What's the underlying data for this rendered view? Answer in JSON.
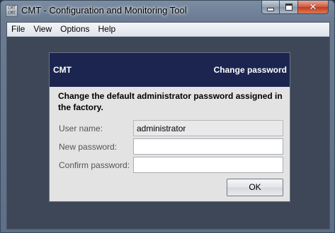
{
  "window": {
    "title": "CMT - Configuration and Monitoring Tool",
    "icon": "cmt-app-icon",
    "caption_buttons": [
      "minimize-icon",
      "maximize-icon",
      "close-icon"
    ]
  },
  "menu": {
    "items": [
      "File",
      "View",
      "Options",
      "Help"
    ]
  },
  "dialog": {
    "app_name": "CMT",
    "title": "Change password",
    "intro": "Change the default administrator password assigned in the factory.",
    "fields": {
      "username": {
        "label": "User name:",
        "value": "administrator"
      },
      "new_password": {
        "label": "New password:",
        "value": ""
      },
      "confirm_password": {
        "label": "Confirm password:",
        "value": ""
      }
    },
    "ok_label": "OK"
  },
  "colors": {
    "dialog_header": "#1b2550",
    "workspace": "#3d4757",
    "dialog_body": "#e3e3e3"
  }
}
